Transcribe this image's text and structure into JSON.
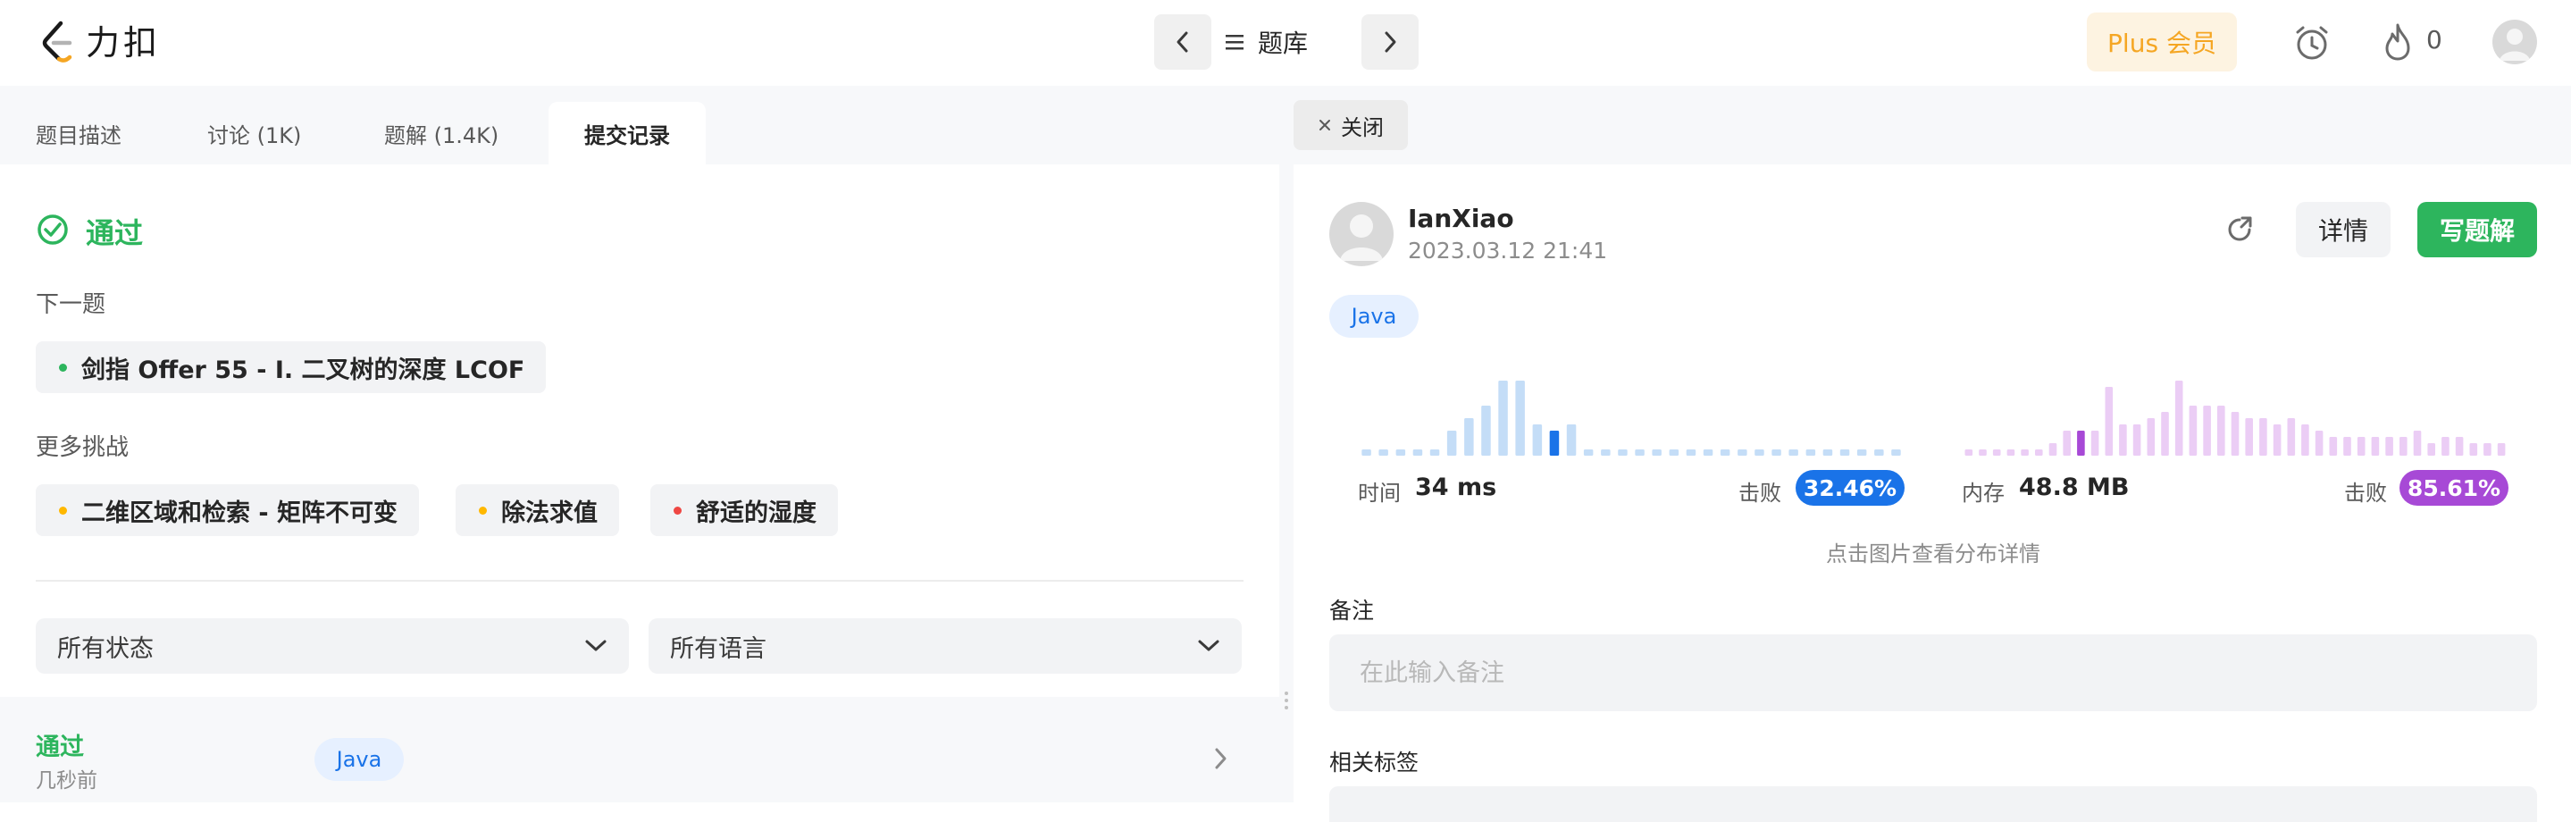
{
  "header": {
    "logo_text": "力扣",
    "center_label": "题库",
    "plus_label": "Plus 会员",
    "fire_count": "0"
  },
  "left": {
    "tabs": [
      {
        "label": "题目描述"
      },
      {
        "label": "讨论 (1K)"
      },
      {
        "label": "题解 (1.4K)"
      },
      {
        "label": "提交记录"
      }
    ],
    "status_title": "通过",
    "next_label": "下一题",
    "next_problem": {
      "title": "剑指 Offer 55 - I. 二叉树的深度 LCOF",
      "dot_color": "#2db55d"
    },
    "more_label": "更多挑战",
    "challenges": [
      {
        "title": "二维区域和检索 - 矩阵不可变",
        "dot_color": "#ffb800"
      },
      {
        "title": "除法求值",
        "dot_color": "#ffb800"
      },
      {
        "title": "舒适的湿度",
        "dot_color": "#ef4743"
      }
    ],
    "filters": {
      "status": "所有状态",
      "language": "所有语言"
    },
    "submission": {
      "status": "通过",
      "time": "几秒前",
      "language": "Java"
    }
  },
  "right": {
    "close_label": "关闭",
    "user": {
      "name": "IanXiao",
      "date": "2023.03.12 21:41"
    },
    "detail_label": "详情",
    "write_label": "写题解",
    "language": "Java",
    "runtime": {
      "label": "时间",
      "value": "34 ms",
      "beats_label": "击败",
      "beats": "32.46%",
      "color": "#1a73e8",
      "light_color": "#c4ddf7",
      "selected_index": 11,
      "histogram": [
        1,
        1,
        1,
        1,
        1,
        4,
        6,
        8,
        12,
        12,
        5,
        4,
        5,
        1,
        1,
        1,
        1,
        1,
        1,
        1,
        1,
        1,
        1,
        1,
        1,
        1,
        1,
        1,
        1,
        1,
        1,
        1
      ]
    },
    "memory": {
      "label": "内存",
      "value": "48.8 MB",
      "beats_label": "击败",
      "beats": "85.61%",
      "color": "#a749d6",
      "light_color": "#ebcdf5",
      "selected_index": 8,
      "histogram": [
        1,
        1,
        1,
        1,
        1,
        1,
        2,
        4,
        4,
        4,
        11,
        5,
        5,
        6,
        7,
        12,
        8,
        8,
        8,
        7,
        6,
        6,
        5,
        6,
        5,
        4,
        3,
        3,
        3,
        3,
        3,
        3,
        4,
        2,
        3,
        3,
        2,
        2,
        2
      ]
    },
    "hint": "点击图片查看分布详情",
    "note_label": "备注",
    "note_placeholder": "在此输入备注",
    "tags_label": "相关标签"
  }
}
